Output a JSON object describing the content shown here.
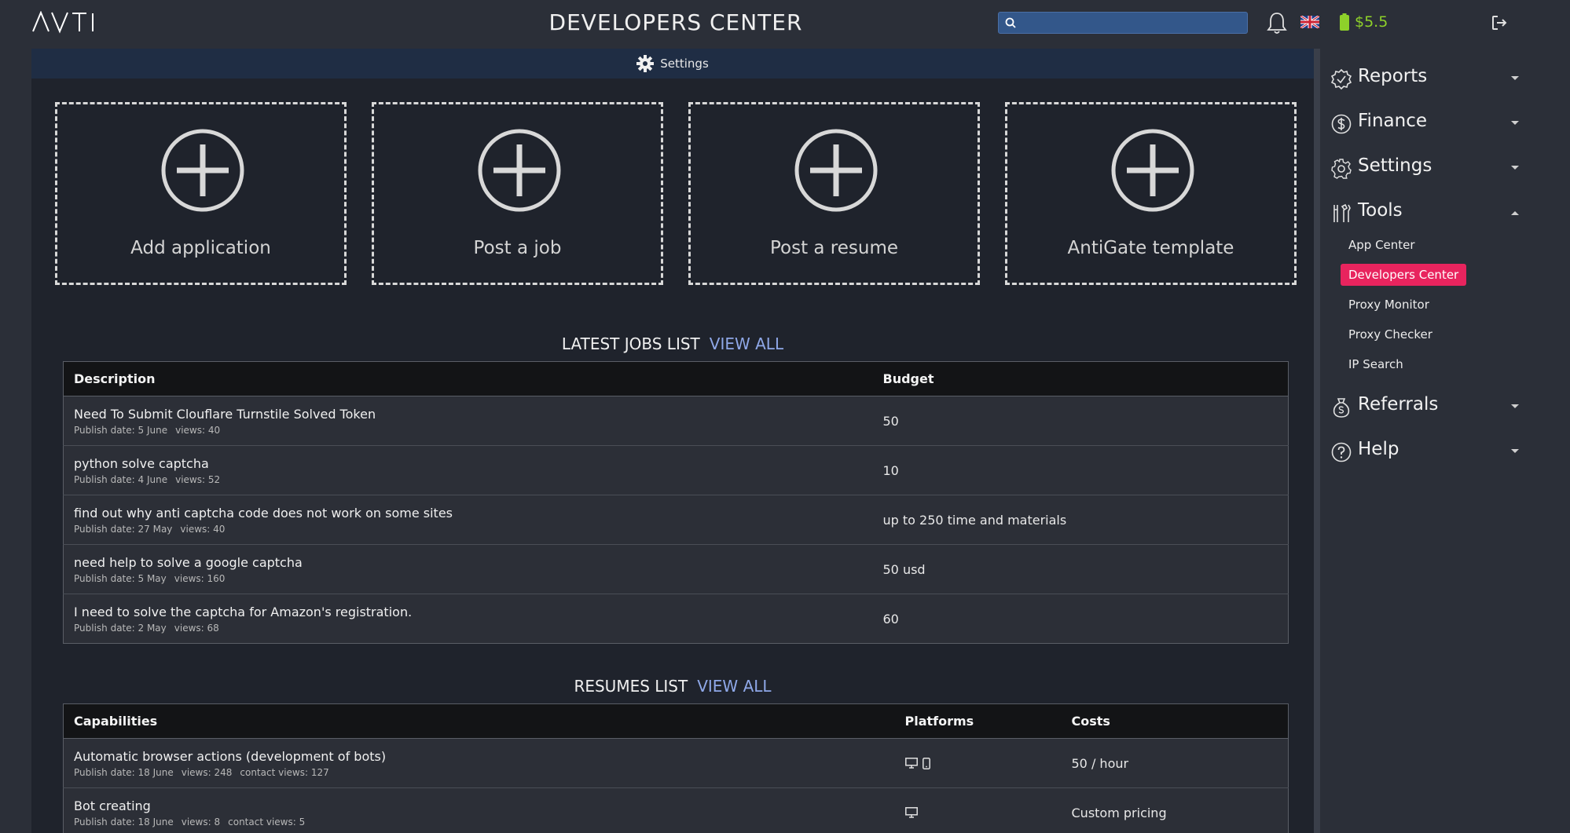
{
  "header": {
    "title": "DEVELOPERS CENTER",
    "search_placeholder": "",
    "balance": "$5.5"
  },
  "settings_bar": {
    "label": "Settings"
  },
  "cards": [
    {
      "label": "Add application"
    },
    {
      "label": "Post a job"
    },
    {
      "label": "Post a resume"
    },
    {
      "label": "AntiGate template"
    }
  ],
  "jobs": {
    "title": "LATEST JOBS LIST",
    "view_all": "VIEW ALL",
    "headers": {
      "description": "Description",
      "budget": "Budget"
    },
    "rows": [
      {
        "description": "Need To Submit Clouflare Turnstile Solved Token",
        "publish": "Publish date: 5 June",
        "views": "views: 40",
        "budget": "50"
      },
      {
        "description": "python solve captcha",
        "publish": "Publish date: 4 June",
        "views": "views: 52",
        "budget": "10"
      },
      {
        "description": "find out why anti captcha code does not work on some sites",
        "publish": "Publish date: 27 May",
        "views": "views: 40",
        "budget": "up to 250 time and materials"
      },
      {
        "description": "need help to solve a google captcha",
        "publish": "Publish date: 5 May",
        "views": "views: 160",
        "budget": "50 usd"
      },
      {
        "description": "I need to solve the captcha for Amazon's registration.",
        "publish": "Publish date: 2 May",
        "views": "views: 68",
        "budget": "60"
      }
    ]
  },
  "resumes": {
    "title": "RESUMES LIST",
    "view_all": "VIEW ALL",
    "headers": {
      "capabilities": "Capabilities",
      "platforms": "Platforms",
      "costs": "Costs"
    },
    "rows": [
      {
        "capability": "Automatic browser actions (development of bots)",
        "publish": "Publish date: 18 June",
        "views": "views: 248",
        "contact_views": "contact views: 127",
        "platforms": [
          "desktop-icon",
          "mobile-icon"
        ],
        "cost": "50 / hour"
      },
      {
        "capability": "Bot creating",
        "publish": "Publish date: 18 June",
        "views": "views: 8",
        "contact_views": "contact views: 5",
        "platforms": [
          "desktop-icon"
        ],
        "cost": "Custom pricing"
      }
    ]
  },
  "sidebar": {
    "items": [
      {
        "label": "Reports",
        "icon": "badge-icon"
      },
      {
        "label": "Finance",
        "icon": "dollar-icon"
      },
      {
        "label": "Settings",
        "icon": "gear-icon"
      },
      {
        "label": "Tools",
        "icon": "tools-icon"
      },
      {
        "label": "Referrals",
        "icon": "money-bag-icon"
      },
      {
        "label": "Help",
        "icon": "help-icon"
      }
    ],
    "tools_sub": [
      {
        "label": "App Center"
      },
      {
        "label": "Developers Center"
      },
      {
        "label": "Proxy Monitor"
      },
      {
        "label": "Proxy Checker"
      },
      {
        "label": "IP Search"
      }
    ]
  },
  "colors": {
    "accent": "#e8245e",
    "balance": "#8ed12a",
    "link": "#8fa8e8",
    "search_bg": "#33578a"
  }
}
